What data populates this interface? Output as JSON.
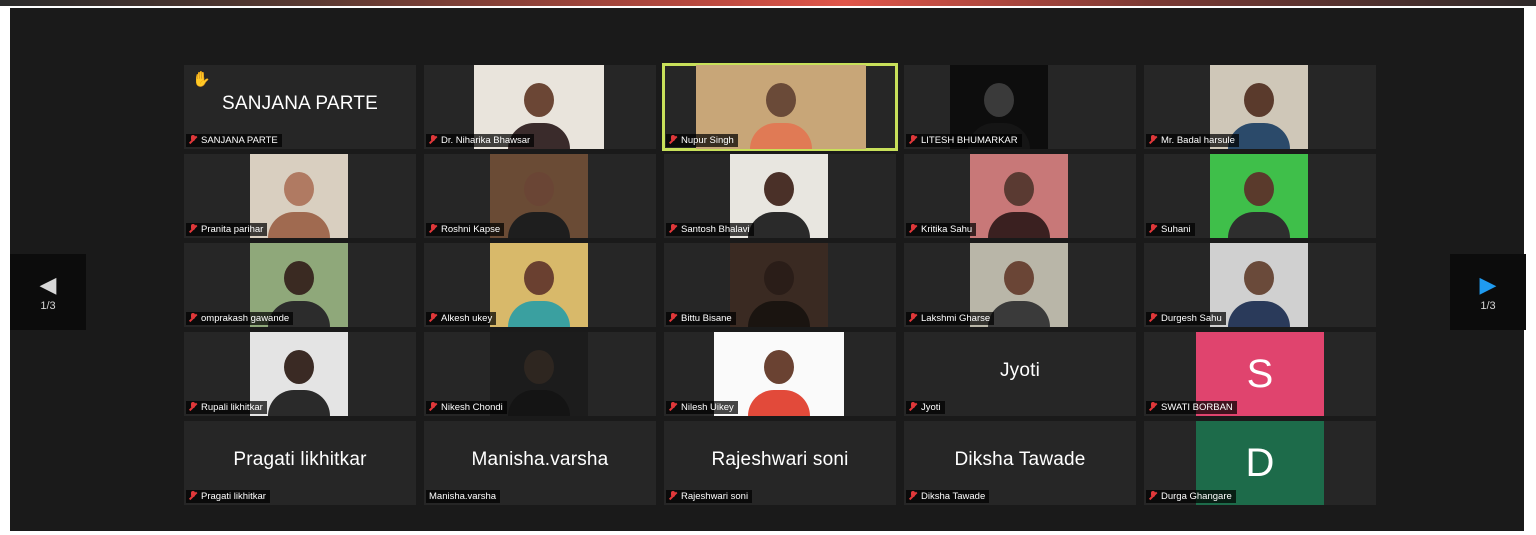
{
  "meeting": {
    "nav_prev": {
      "icon": "arrow-left-icon",
      "page": "1/3"
    },
    "nav_next": {
      "icon": "arrow-right-icon",
      "page": "1/3"
    },
    "accent_active": "#c8e05a",
    "muted_color": "#e0383a"
  },
  "participants": [
    {
      "label": "SANJANA PARTE",
      "display": "SANJANA PARTE",
      "hand_raised": true
    },
    {
      "label": "Dr. Niharika Bhawsar"
    },
    {
      "label": "Nupur Singh",
      "active_speaker": true
    },
    {
      "label": "LITESH BHUMARKAR"
    },
    {
      "label": "Mr. Badal harsule"
    },
    {
      "label": "Pranita parihar"
    },
    {
      "label": "Roshni Kapse"
    },
    {
      "label": "Santosh Bhalavi"
    },
    {
      "label": "Kritika Sahu"
    },
    {
      "label": "Suhani"
    },
    {
      "label": "omprakash gawande"
    },
    {
      "label": "Alkesh ukey"
    },
    {
      "label": "Bittu Bisane"
    },
    {
      "label": "Lakshmi Gharse"
    },
    {
      "label": "Durgesh Sahu"
    },
    {
      "label": "Rupali likhitkar"
    },
    {
      "label": "Nikesh Chondi"
    },
    {
      "label": "Nilesh Uikey"
    },
    {
      "label": "Jyoti",
      "display": "Jyoti"
    },
    {
      "label": "SWATI BORBAN",
      "avatar_letter": "S",
      "avatar_color": "#e0446e"
    },
    {
      "label": "Pragati likhitkar",
      "display": "Pragati likhitkar"
    },
    {
      "label": "Manisha.varsha",
      "display": "Manisha.varsha"
    },
    {
      "label": "Rajeshwari soni",
      "display": "Rajeshwari soni"
    },
    {
      "label": "Diksha Tawade",
      "display": "Diksha Tawade"
    },
    {
      "label": "Durga Ghangare",
      "avatar_letter": "D",
      "avatar_color": "#1d6b4a"
    }
  ]
}
